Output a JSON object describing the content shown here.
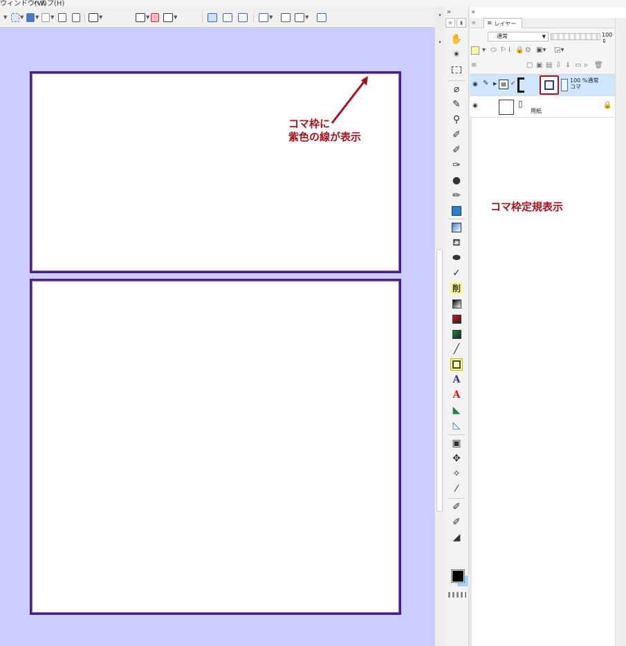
{
  "menubar": {
    "items": [
      "ウィンドウ(W)",
      "ヘルプ(H)"
    ]
  },
  "toolbar": {
    "icons": [
      "select-mode-icon",
      "transform-icon",
      "layer-move-icon",
      "crop-icon",
      "rotate-icon",
      "flip-icon",
      "undo-history-icon",
      "frame-border-icon",
      "frame-divide-icon",
      "frame-folder-icon",
      "snap-ruler-icon",
      "snap-special-ruler-icon",
      "snap-grid-icon",
      "show-frame-icon",
      "show-ruler-icon",
      "show-grid-icon",
      "show-frame-border-icon"
    ]
  },
  "canvas": {
    "background_color": "#ccccff",
    "frame_border_color": "#4a1e8c",
    "annotation_frame": "コマ枠に\n紫色の線が表示",
    "annotation_frame_line1": "コマ枠に",
    "annotation_frame_line2": "紫色の線が表示",
    "annotation_ruler": "コマ枠定規表示",
    "annotation_color": "#a3111e"
  },
  "tools": {
    "icons": [
      "hand-icon",
      "magic-wand-icon",
      "selection-icon",
      "eraser-icon",
      "pen-icon",
      "stamp-icon",
      "brush-icon",
      "brush-icon",
      "airbrush-icon",
      "watercolor-icon",
      "pencil-icon",
      "decoration-icon",
      "fill-icon",
      "fill-bucket-icon",
      "blend-icon",
      "correction-icon",
      "erase-label-icon",
      "gradient-icon",
      "gradient-icon",
      "gradient-icon",
      "line-icon",
      "frame-border-tool-icon",
      "text-icon",
      "text-icon",
      "ruler-icon",
      "ruler-icon",
      "object-icon",
      "operation-icon",
      "eyedropper-icon",
      "dropper-icon",
      "brush-icon",
      "brush-icon",
      "eraser-icon"
    ],
    "erase_label": "削",
    "text_label": "A",
    "main_color": "#000000",
    "sub_color": "#a7cfff"
  },
  "layer_panel": {
    "tab_label": "レイヤー",
    "blend_mode": "通常",
    "opacity": "100",
    "layers": [
      {
        "info_line1": "100 %通常",
        "info_line2": "コマ",
        "selected": true
      },
      {
        "name": "用紙",
        "locked": true,
        "selected": false
      }
    ],
    "highlight_color": "#a3111e"
  }
}
